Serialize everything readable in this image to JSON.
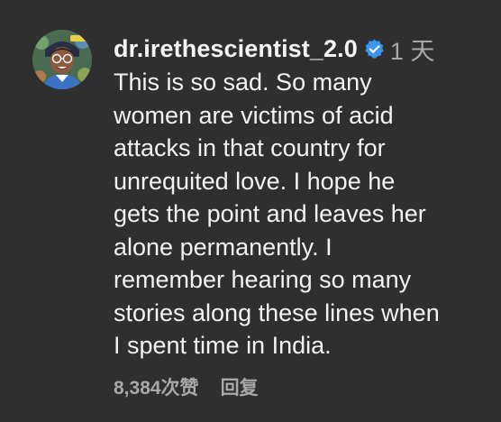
{
  "comment": {
    "username": "dr.irethescientist_2.0",
    "verified_icon": "verified-badge-icon",
    "time": "1 天",
    "text": "This is so sad. So many\nwomen are victims of acid\nattacks in that country for\nunrequited love. I hope he\ngets the point and leaves her\nalone permanently. I\nremember hearing so many\nstories along these lines when\nI spent time in India.",
    "likes": "8,384次赞",
    "reply_label": "回复"
  },
  "colors": {
    "background": "#2f2f2f",
    "text": "#f2f2f2",
    "muted": "#a8a8a8",
    "verified": "#3897f0"
  }
}
